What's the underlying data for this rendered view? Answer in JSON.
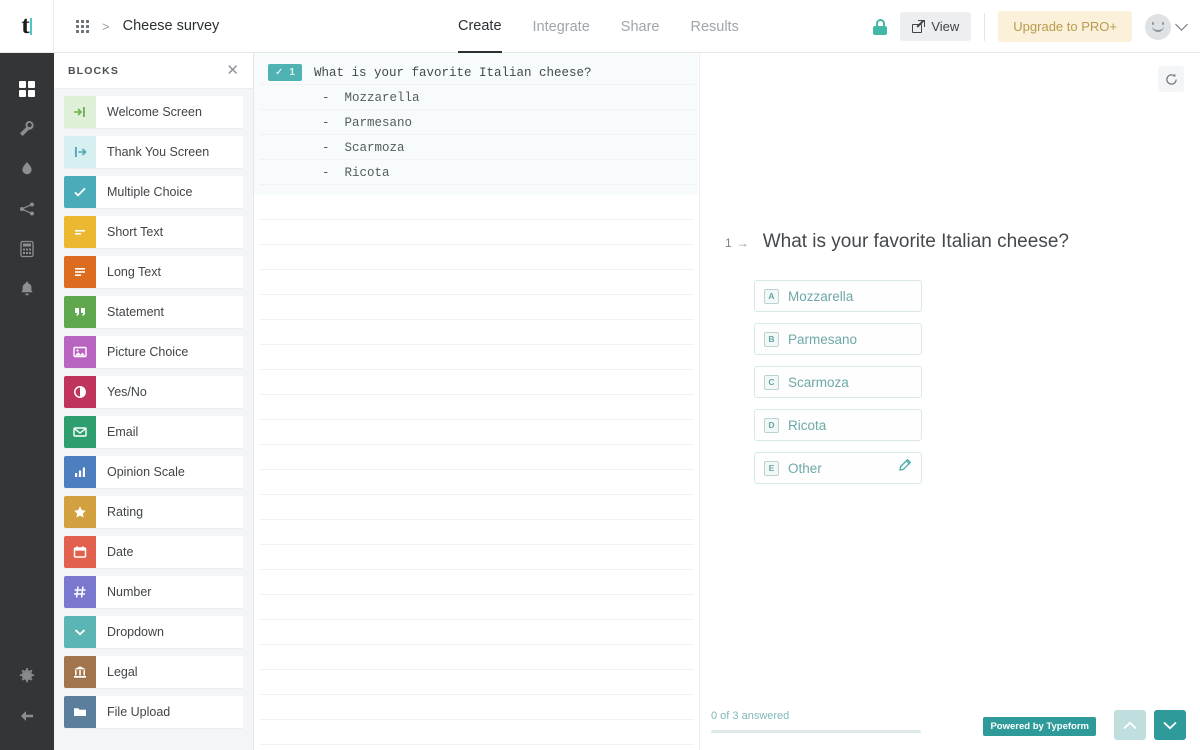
{
  "brand": {
    "logo_letter": "t",
    "accent": "#4fb3b3",
    "teal_dark": "#2e9a9a"
  },
  "topbar": {
    "grid_icon": "apps-grid-icon",
    "breadcrumb_separator": ">",
    "form_title": "Cheese survey",
    "tabs": [
      {
        "label": "Create",
        "active": true
      },
      {
        "label": "Integrate",
        "active": false
      },
      {
        "label": "Share",
        "active": false
      },
      {
        "label": "Results",
        "active": false
      }
    ],
    "lock_icon": "lock-icon",
    "view_label": "View",
    "view_icon": "external-link-icon",
    "upgrade_label": "Upgrade to PRO+",
    "avatar_icon": "smiley-avatar-icon",
    "account_chevron": "chevron-down-icon"
  },
  "rail": {
    "items": [
      {
        "name": "blocks",
        "icon": "grid-blocks-icon",
        "active": true
      },
      {
        "name": "design",
        "icon": "wrench-icon",
        "active": false
      },
      {
        "name": "theme",
        "icon": "droplet-icon",
        "active": false
      },
      {
        "name": "logic",
        "icon": "share-nodes-icon",
        "active": false
      },
      {
        "name": "calculator",
        "icon": "calculator-icon",
        "active": false
      },
      {
        "name": "notifications",
        "icon": "bell-icon",
        "active": false
      }
    ],
    "bottom_items": [
      {
        "name": "settings",
        "icon": "gear-icon"
      },
      {
        "name": "back",
        "icon": "arrow-left-icon"
      }
    ]
  },
  "blocks_panel": {
    "title": "BLOCKS",
    "close_icon": "close-icon",
    "items": [
      {
        "label": "Welcome Screen",
        "icon": "arrow-to-line-right-icon",
        "bg": "#dff0d8",
        "fg": "#6ab04c"
      },
      {
        "label": "Thank You Screen",
        "icon": "arrow-from-line-right-icon",
        "bg": "#d6eff1",
        "fg": "#4aa8b0"
      },
      {
        "label": "Multiple Choice",
        "icon": "check-icon",
        "bg": "#4aacb8",
        "fg": "#ffffff"
      },
      {
        "label": "Short Text",
        "icon": "short-lines-icon",
        "bg": "#ecb731",
        "fg": "#ffffff"
      },
      {
        "label": "Long Text",
        "icon": "long-lines-icon",
        "bg": "#dd6b20",
        "fg": "#ffffff"
      },
      {
        "label": "Statement",
        "icon": "quote-icon",
        "bg": "#5fa84e",
        "fg": "#ffffff"
      },
      {
        "label": "Picture Choice",
        "icon": "image-icon",
        "bg": "#b963c0",
        "fg": "#ffffff"
      },
      {
        "label": "Yes/No",
        "icon": "half-circle-icon",
        "bg": "#c0335c",
        "fg": "#ffffff"
      },
      {
        "label": "Email",
        "icon": "envelope-icon",
        "bg": "#2f9e6e",
        "fg": "#ffffff"
      },
      {
        "label": "Opinion Scale",
        "icon": "bar-chart-icon",
        "bg": "#4d7fc0",
        "fg": "#ffffff"
      },
      {
        "label": "Rating",
        "icon": "star-icon",
        "bg": "#d2a03f",
        "fg": "#ffffff"
      },
      {
        "label": "Date",
        "icon": "calendar-icon",
        "bg": "#e2604e",
        "fg": "#ffffff"
      },
      {
        "label": "Number",
        "icon": "hash-icon",
        "bg": "#7a77cf",
        "fg": "#ffffff"
      },
      {
        "label": "Dropdown",
        "icon": "chevron-down-icon",
        "bg": "#5cb5b5",
        "fg": "#ffffff"
      },
      {
        "label": "Legal",
        "icon": "bank-icon",
        "bg": "#a2744e",
        "fg": "#ffffff"
      },
      {
        "label": "File Upload",
        "icon": "folder-icon",
        "bg": "#5b7e9c",
        "fg": "#ffffff"
      }
    ]
  },
  "editor": {
    "question_number": "1",
    "question_check": "✓",
    "question_text": "What is your favorite Italian cheese?",
    "choices": [
      "-  Mozzarella",
      "-  Parmesano",
      "-  Scarmoza",
      "-  Ricota"
    ],
    "empty_line_count": 22
  },
  "preview": {
    "refresh_icon": "refresh-icon",
    "question_number": "1",
    "question_arrow": "→",
    "question_text": "What is your favorite Italian cheese?",
    "choices": [
      {
        "key": "A",
        "label": "Mozzarella",
        "editable": false
      },
      {
        "key": "B",
        "label": "Parmesano",
        "editable": false
      },
      {
        "key": "C",
        "label": "Scarmoza",
        "editable": false
      },
      {
        "key": "D",
        "label": "Ricota",
        "editable": false
      },
      {
        "key": "E",
        "label": "Other",
        "editable": true,
        "edit_icon": "pencil-icon"
      }
    ],
    "footer": {
      "progress_label": "0 of 3 answered",
      "progress_percent": 0,
      "powered_label": "Powered by Typeform",
      "prev_icon": "chevron-up-icon",
      "next_icon": "chevron-down-icon"
    }
  }
}
